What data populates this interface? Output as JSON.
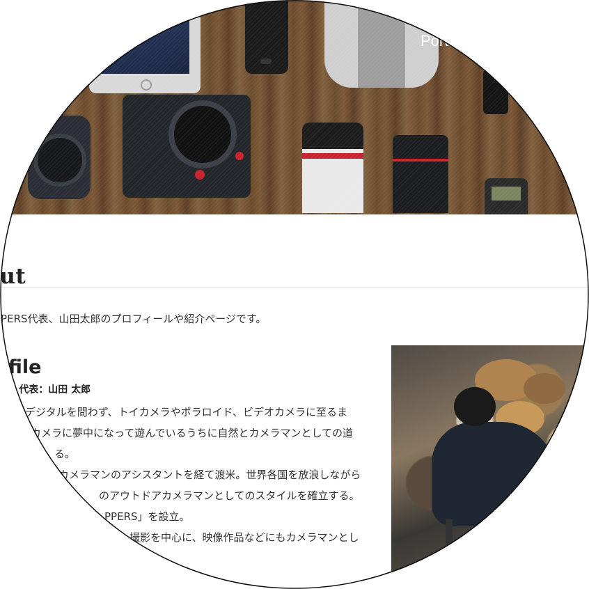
{
  "nav": {
    "portfolio_label": "Portf"
  },
  "page": {
    "title": "bout",
    "intro": "PPERS代表、山田太郎のプロフィールや紹介ページです。"
  },
  "profile": {
    "heading": "rofile",
    "name_line": "ERS 代表：山田 太郎",
    "bio_lines": [
      "デジタルを問わず、トイカメラやポラロイド、ビデオカメラに至るま",
      "カメラに夢中になって遊んでいるうちに自然とカメラマンとしての道",
      "る。",
      "カメラマンのアシスタントを経て渡米。世界各国を放浪しながら",
      "のアウトドアカメラマンとしてのスタイルを確立する。",
      "PPERS」を設立。",
      "撮影を中心に、映像作品などにもカメラマンとし"
    ]
  }
}
